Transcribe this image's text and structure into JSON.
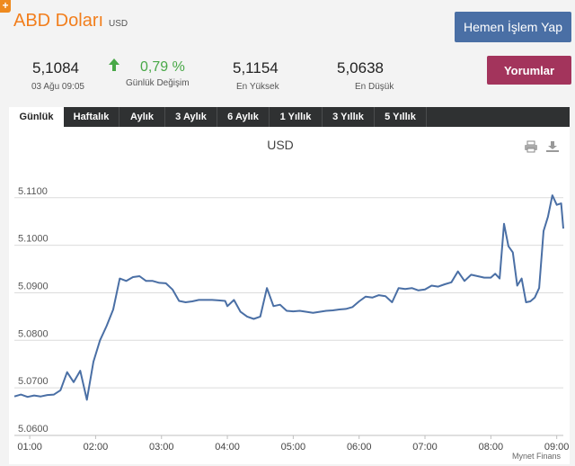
{
  "header": {
    "corner_icon": "plus-icon",
    "title": "ABD Doları",
    "code": "USD",
    "trade_button": "Hemen İşlem Yap",
    "comments_button": "Yorumlar"
  },
  "stats": {
    "price": "5,1084",
    "datetime": "03 Ağu 09:05",
    "change_pct": "0,79 %",
    "change_label": "Günlük Değişim",
    "change_icon": "up-arrow-icon",
    "high": "5,1154",
    "high_label": "En Yüksek",
    "low": "5,0638",
    "low_label": "En Düşük"
  },
  "tabs": [
    {
      "label": "Günlük",
      "active": true
    },
    {
      "label": "Haftalık",
      "active": false
    },
    {
      "label": "Aylık",
      "active": false
    },
    {
      "label": "3 Aylık",
      "active": false
    },
    {
      "label": "6 Aylık",
      "active": false
    },
    {
      "label": "1 Yıllık",
      "active": false
    },
    {
      "label": "3 Yıllık",
      "active": false
    },
    {
      "label": "5 Yıllık",
      "active": false
    }
  ],
  "colors": {
    "accent": "#f27e1c",
    "positive": "#48a847",
    "trade_button": "#4a6fa5",
    "comments_button": "#a3345c",
    "tab_bar": "#2f3132",
    "line": "#4a6fa5"
  },
  "chart_data": {
    "type": "line",
    "title": "USD",
    "credit": "Mynet Finans",
    "xlabel": "",
    "ylabel": "",
    "ylim": [
      5.06,
      5.1145
    ],
    "yticks": [
      "5.0600",
      "5.0700",
      "5.0800",
      "5.0900",
      "5.1000",
      "5.1100"
    ],
    "xticks": [
      "01:00",
      "02:00",
      "03:00",
      "04:00",
      "05:00",
      "06:00",
      "07:00",
      "08:00",
      "09:00"
    ],
    "grid": true,
    "series": [
      {
        "name": "",
        "x": [
          "00:46",
          "00:52",
          "00:58",
          "01:04",
          "01:10",
          "01:16",
          "01:22",
          "01:28",
          "01:34",
          "01:40",
          "01:46",
          "01:52",
          "01:58",
          "02:04",
          "02:10",
          "02:16",
          "02:22",
          "02:28",
          "02:34",
          "02:40",
          "02:46",
          "02:52",
          "02:58",
          "03:04",
          "03:10",
          "03:16",
          "03:22",
          "03:28",
          "03:34",
          "03:40",
          "03:46",
          "03:52",
          "03:58",
          "04:00",
          "04:06",
          "04:12",
          "04:18",
          "04:24",
          "04:30",
          "04:36",
          "04:42",
          "04:48",
          "04:54",
          "05:00",
          "05:06",
          "05:12",
          "05:18",
          "05:24",
          "05:30",
          "05:36",
          "05:42",
          "05:48",
          "05:54",
          "06:00",
          "06:06",
          "06:12",
          "06:18",
          "06:24",
          "06:30",
          "06:36",
          "06:42",
          "06:48",
          "06:54",
          "07:00",
          "07:06",
          "07:12",
          "07:18",
          "07:24",
          "07:30",
          "07:36",
          "07:42",
          "07:48",
          "07:54",
          "08:00",
          "08:04",
          "08:08",
          "08:12",
          "08:16",
          "08:20",
          "08:24",
          "08:28",
          "08:32",
          "08:36",
          "08:40",
          "08:44",
          "08:48",
          "08:52",
          "08:56",
          "09:00",
          "09:04",
          "09:06"
        ],
        "y": [
          5.0682,
          5.0686,
          5.0681,
          5.0684,
          5.0682,
          5.0685,
          5.0686,
          5.0695,
          5.0733,
          5.0712,
          5.0736,
          5.0675,
          5.0755,
          5.08,
          5.083,
          5.0865,
          5.093,
          5.0925,
          5.0933,
          5.0935,
          5.0925,
          5.0925,
          5.0921,
          5.092,
          5.0907,
          5.0883,
          5.088,
          5.0882,
          5.0885,
          5.0885,
          5.0885,
          5.0884,
          5.0883,
          5.0872,
          5.0885,
          5.086,
          5.085,
          5.0845,
          5.085,
          5.091,
          5.0872,
          5.0875,
          5.0862,
          5.0861,
          5.0862,
          5.086,
          5.0858,
          5.086,
          5.0862,
          5.0863,
          5.0865,
          5.0866,
          5.087,
          5.0882,
          5.0892,
          5.089,
          5.0895,
          5.0893,
          5.088,
          5.091,
          5.0908,
          5.091,
          5.0905,
          5.0907,
          5.0915,
          5.0913,
          5.0918,
          5.0922,
          5.0945,
          5.0925,
          5.0938,
          5.0935,
          5.0932,
          5.0932,
          5.094,
          5.093,
          5.1045,
          5.0998,
          5.0985,
          5.0915,
          5.093,
          5.088,
          5.0882,
          5.089,
          5.091,
          5.103,
          5.106,
          5.1105,
          5.1085,
          5.1088,
          5.1035
        ]
      }
    ]
  }
}
